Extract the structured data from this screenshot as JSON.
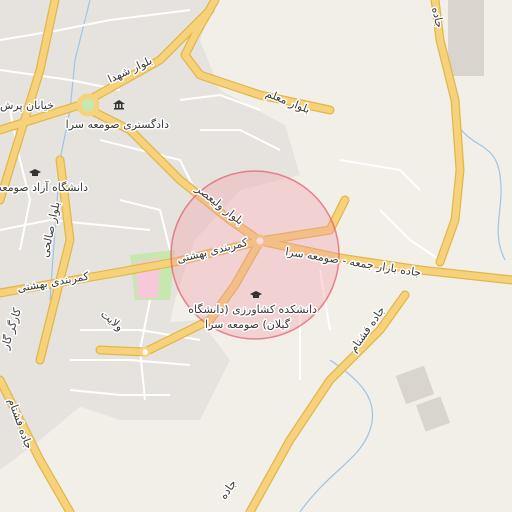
{
  "map": {
    "colors": {
      "background": "#f2efe9",
      "urban": "#e6e3df",
      "minor_road": "#ffffff",
      "major_road_fill": "#f6d27a",
      "major_road_casing": "#e3b64c",
      "water": "#9ec4e8",
      "green": "#c8e6b0",
      "pink_area": "#f5c9d9",
      "highlight_fill": "#f19aa6",
      "highlight_stroke": "#e05a6a"
    },
    "road_labels": {
      "blvd_shohada": "بلوار شهدا",
      "blvd_moallem": "بلوار معلم",
      "khiaban_barsh": "خیابان پرش",
      "blvd_salehi": "بلوار صالحی",
      "blvd_valiasr": "بلوار ولیعصر",
      "kamarbandi_left": "کمربندی بهشتی",
      "kamarbandi_center": "کمربندی بهشتی",
      "jomeh_bazar": "جاده بازار جمعه - صومعه سرا",
      "jade_right": "جاده",
      "jade_fashtam_left": "جاده فشتام",
      "jade_fashtam_right": "جاده فشتام",
      "jade_bottom": "جاده",
      "karkhaneh": "کارگر گار",
      "velayat": "ولایت"
    },
    "places": {
      "courthouse": {
        "icon": "courthouse-icon",
        "label": "دادگستری صومعه سرا"
      },
      "azad_university": {
        "icon": "university-icon",
        "label": "دانشگاه آزاد صومعه"
      },
      "agri_faculty": {
        "icon": "university-icon",
        "label_line1": "دانشکده کشاورزی (دانشگاه",
        "label_line2": "گیلان) صومعه سرا"
      }
    }
  }
}
